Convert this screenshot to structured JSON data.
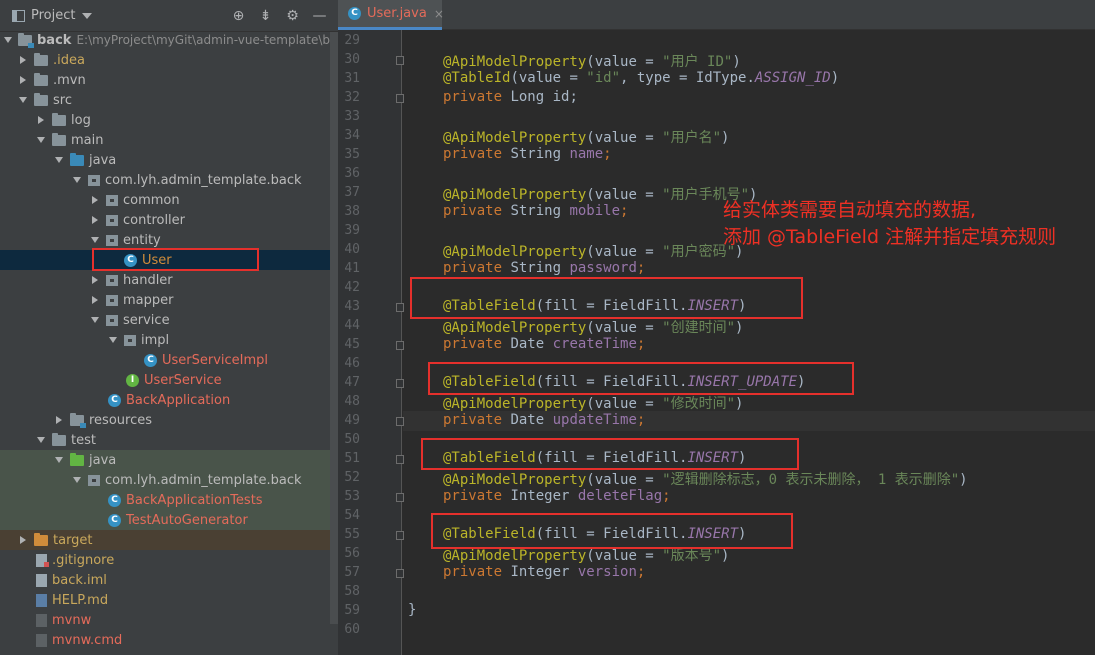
{
  "project_panel": {
    "title": "Project",
    "tree": [
      {
        "label": "back",
        "path": "E:\\myProject\\myGit\\admin-vue-template\\back",
        "icon": "module-folder-icon",
        "expanded": true
      },
      {
        "label": ".idea",
        "icon": "folder-icon"
      },
      {
        "label": ".mvn",
        "icon": "folder-icon"
      },
      {
        "label": "src",
        "icon": "folder-icon",
        "expanded": true
      },
      {
        "label": "log",
        "icon": "folder-icon"
      },
      {
        "label": "main",
        "icon": "folder-icon",
        "expanded": true
      },
      {
        "label": "java",
        "icon": "source-folder-icon",
        "expanded": true
      },
      {
        "label": "com.lyh.admin_template.back",
        "icon": "package-icon",
        "expanded": true
      },
      {
        "label": "common",
        "icon": "package-icon"
      },
      {
        "label": "controller",
        "icon": "package-icon"
      },
      {
        "label": "entity",
        "icon": "package-icon",
        "expanded": true
      },
      {
        "label": "User",
        "icon": "class-icon",
        "selected": true
      },
      {
        "label": "handler",
        "icon": "package-icon"
      },
      {
        "label": "mapper",
        "icon": "package-icon"
      },
      {
        "label": "service",
        "icon": "package-icon",
        "expanded": true
      },
      {
        "label": "impl",
        "icon": "package-icon",
        "expanded": true
      },
      {
        "label": "UserServiceImpl",
        "icon": "class-icon"
      },
      {
        "label": "UserService",
        "icon": "interface-icon"
      },
      {
        "label": "BackApplication",
        "icon": "spring-class-icon"
      },
      {
        "label": "resources",
        "icon": "resources-folder-icon"
      },
      {
        "label": "test",
        "icon": "folder-icon",
        "expanded": true
      },
      {
        "label": "java",
        "icon": "test-folder-icon",
        "expanded": true
      },
      {
        "label": "com.lyh.admin_template.back",
        "icon": "package-icon",
        "expanded": true
      },
      {
        "label": "BackApplicationTests",
        "icon": "spring-class-icon"
      },
      {
        "label": "TestAutoGenerator",
        "icon": "spring-class-icon"
      },
      {
        "label": "target",
        "icon": "excluded-folder-icon"
      },
      {
        "label": ".gitignore",
        "icon": "gitignore-file-icon"
      },
      {
        "label": "back.iml",
        "icon": "iml-file-icon"
      },
      {
        "label": "HELP.md",
        "icon": "markdown-file-icon"
      },
      {
        "label": "mvnw",
        "icon": "shell-file-icon"
      },
      {
        "label": "mvnw.cmd",
        "icon": "cmd-file-icon"
      }
    ]
  },
  "editor": {
    "tab_label": "User.java",
    "tab_close": "×",
    "line_numbers": [
      "29",
      "30",
      "31",
      "32",
      "33",
      "34",
      "35",
      "36",
      "37",
      "38",
      "39",
      "40",
      "41",
      "42",
      "43",
      "44",
      "45",
      "46",
      "47",
      "48",
      "49",
      "50",
      "51",
      "52",
      "53",
      "54",
      "55",
      "56",
      "57",
      "58",
      "59",
      "60"
    ],
    "lines": {
      "l30": [
        "@ApiModelProperty",
        "(value = ",
        "\"用户 ID\"",
        ")"
      ],
      "l31": [
        "@TableId",
        "(value = ",
        "\"id\"",
        ", type = IdType.",
        "ASSIGN_ID",
        ")"
      ],
      "l32": [
        "private ",
        "Long id;"
      ],
      "l34": [
        "@ApiModelProperty",
        "(value = ",
        "\"用户名\"",
        ")"
      ],
      "l35": [
        "private ",
        "String ",
        "name",
        ";"
      ],
      "l37": [
        "@ApiModelProperty",
        "(value = ",
        "\"用户手机号\"",
        ")"
      ],
      "l38": [
        "private ",
        "String ",
        "mobile",
        ";"
      ],
      "l40": [
        "@ApiModelProperty",
        "(value = ",
        "\"用户密码\"",
        ")"
      ],
      "l41": [
        "private ",
        "String ",
        "password",
        ";"
      ],
      "l43": [
        "@TableField",
        "(fill = FieldFill.",
        "INSERT",
        ")"
      ],
      "l44": [
        "@ApiModelProperty",
        "(value = ",
        "\"创建时间\"",
        ")"
      ],
      "l45": [
        "private ",
        "Date ",
        "createTime",
        ";"
      ],
      "l47": [
        "@TableField",
        "(fill = FieldFill.",
        "INSERT_UPDATE",
        ")"
      ],
      "l48": [
        "@ApiModelProperty",
        "(value = ",
        "\"修改时间\"",
        ")"
      ],
      "l49": [
        "private ",
        "Date ",
        "updateTime",
        ";"
      ],
      "l51": [
        "@TableField",
        "(fill = FieldFill.",
        "INSERT",
        ")"
      ],
      "l52": [
        "@ApiModelProperty",
        "(value = ",
        "\"逻辑删除标志，0 表示未删除， 1 表示删除\"",
        ")"
      ],
      "l53": [
        "private ",
        "Integer ",
        "deleteFlag",
        ";"
      ],
      "l55": [
        "@TableField",
        "(fill = FieldFill.",
        "INSERT",
        ")"
      ],
      "l56": [
        "@ApiModelProperty",
        "(value = ",
        "\"版本号\"",
        ")"
      ],
      "l57": [
        "private ",
        "Integer ",
        "version",
        ";"
      ],
      "l59": [
        "}"
      ]
    },
    "callout": [
      "给实体类需要自动填充的数据,",
      "添加 @TableField 注解并指定填充规则"
    ]
  },
  "colors": {
    "annotation": "#bbb529",
    "keyword": "#cc7832",
    "string": "#6a8759",
    "constant": "#9876aa",
    "highlight_box": "#e5302c",
    "callout_text": "#ee3024",
    "selection": "#0d293e"
  }
}
